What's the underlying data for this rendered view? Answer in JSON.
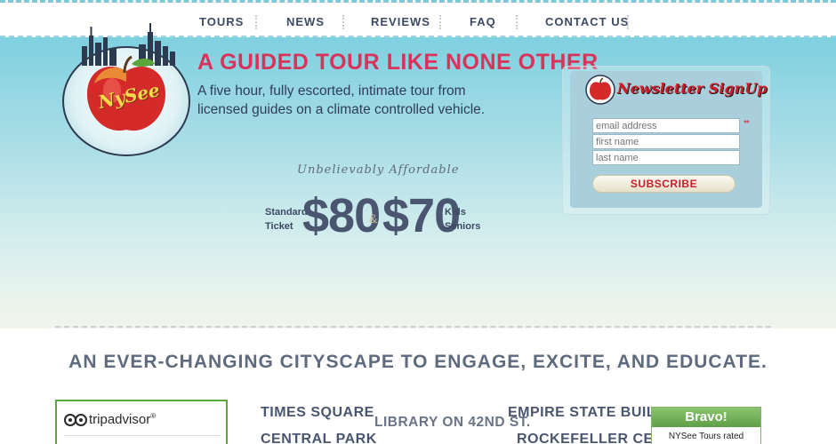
{
  "nav": {
    "items": [
      {
        "label": "TOURS"
      },
      {
        "label": "NEWS"
      },
      {
        "label": "REVIEWS"
      },
      {
        "label": "FAQ"
      },
      {
        "label": "CONTACT US"
      }
    ]
  },
  "logo": {
    "text": "NySee"
  },
  "hero": {
    "headline": "A GUIDED TOUR LIKE NONE OTHER",
    "subhead": "A five hour, fully escorted, intimate tour from licensed guides on a climate controlled vehicle."
  },
  "pricing": {
    "tagline": "Unbelievably Affordable",
    "left_label_line1": "Standard",
    "left_label_line2": "Ticket",
    "price_standard": "$80",
    "ampersand": "&",
    "price_kids": "$70",
    "right_label_line1": "Kids",
    "right_label_line2": "Seniors"
  },
  "newsletter": {
    "title": "Newsletter SignUp",
    "email_placeholder": "email address",
    "first_placeholder": "first name",
    "last_placeholder": "last name",
    "required_mark": "**",
    "subscribe_label": "SUBSCRIBE"
  },
  "cityscape": {
    "heading": "AN EVER-CHANGING CITYSCAPE TO ENGAGE, EXCITE, AND EDUCATE.",
    "places": {
      "times_square": "TIMES SQUARE",
      "central_park": "CENTRAL PARK",
      "library": "LIBRARY ON 42ND ST.",
      "empire_state": "EMPIRE STATE BUILDING",
      "rockefeller": "ROCKEFELLER CENTER"
    }
  },
  "tripadvisor": {
    "brand": "tripadvisor",
    "trademark": "®"
  },
  "bravo": {
    "title": "Bravo!",
    "text": "NYSee Tours rated"
  },
  "colors": {
    "headline": "#d8335a",
    "nav_text": "#3d4a63",
    "sky_top": "#7fd0e0",
    "subscribe_text": "#c8202f",
    "trip_border": "#5aa63c"
  }
}
